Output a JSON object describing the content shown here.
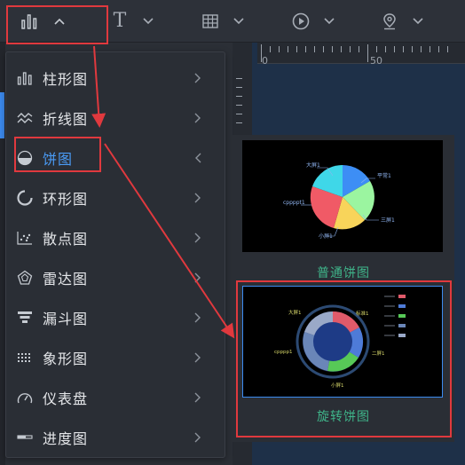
{
  "toolbar": {
    "items": [
      "chart-icon",
      "text-icon",
      "table-icon",
      "media-icon",
      "map-icon"
    ],
    "text_glyph": "T"
  },
  "ruler": {
    "labels": [
      "0",
      "50"
    ]
  },
  "menu": {
    "items": [
      {
        "label": "柱形图",
        "icon": "bar-chart-icon"
      },
      {
        "label": "折线图",
        "icon": "line-chart-icon"
      },
      {
        "label": "饼图",
        "icon": "pie-chart-icon",
        "active": true
      },
      {
        "label": "环形图",
        "icon": "ring-chart-icon"
      },
      {
        "label": "散点图",
        "icon": "scatter-chart-icon"
      },
      {
        "label": "雷达图",
        "icon": "radar-chart-icon"
      },
      {
        "label": "漏斗图",
        "icon": "funnel-chart-icon"
      },
      {
        "label": "象形图",
        "icon": "pictorial-chart-icon"
      },
      {
        "label": "仪表盘",
        "icon": "gauge-icon"
      },
      {
        "label": "进度图",
        "icon": "progress-chart-icon"
      }
    ]
  },
  "submenu": {
    "items": [
      {
        "label": "普通饼图"
      },
      {
        "label": "旋转饼图"
      }
    ],
    "thumb1_labels": [
      "大屏1",
      "平常1",
      "三屏1",
      "小屏1",
      "cppppt1"
    ],
    "thumb2_labels": [
      "大屏1",
      "标准1",
      "二屏1",
      "小屏1",
      "cpppp1"
    ]
  },
  "colors": {
    "accent": "#3c8bf0",
    "highlight": "#e0393e",
    "sub_label": "#3fb58a"
  }
}
